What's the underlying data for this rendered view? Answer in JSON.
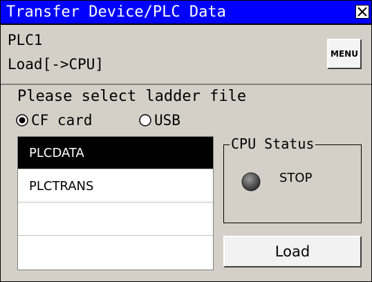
{
  "window": {
    "title": "Transfer Device/PLC Data",
    "close_icon": "close-icon"
  },
  "header": {
    "plc_name": "PLC1",
    "mode": "Load[->CPU]",
    "menu_label": "MENU"
  },
  "source": {
    "prompt": "Please select ladder file",
    "options": [
      {
        "label": "CF card",
        "selected": true
      },
      {
        "label": "USB",
        "selected": false
      }
    ]
  },
  "files": [
    {
      "name": "PLCDATA",
      "selected": true
    },
    {
      "name": "PLCTRANS",
      "selected": false
    },
    {
      "name": "",
      "selected": false
    },
    {
      "name": "",
      "selected": false
    }
  ],
  "cpu_status": {
    "legend": "CPU Status",
    "state": "STOP",
    "indicator_color": "#505050"
  },
  "actions": {
    "load_label": "Load"
  },
  "colors": {
    "title_bar": "#0000ff",
    "panel": "#d4d0c8",
    "selection": "#000000"
  }
}
